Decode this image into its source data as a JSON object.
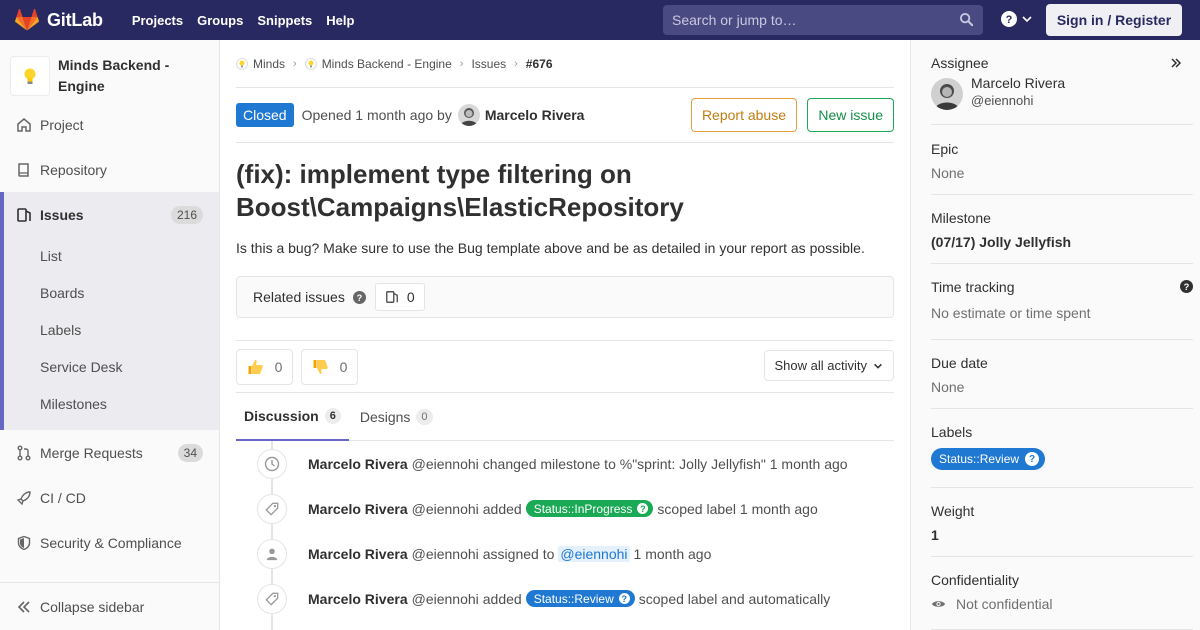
{
  "navbar": {
    "brand": "GitLab",
    "links": [
      "Projects",
      "Groups",
      "Snippets",
      "Help"
    ],
    "search_placeholder": "Search or jump to…",
    "signin_label": "Sign in / Register"
  },
  "sidebar": {
    "project_name": "Minds Backend - Engine",
    "items": [
      {
        "label": "Project",
        "icon": "home-icon"
      },
      {
        "label": "Repository",
        "icon": "book-icon"
      },
      {
        "label": "Issues",
        "icon": "issues-icon",
        "count": "216"
      },
      {
        "label": "Merge Requests",
        "icon": "merge-request-icon",
        "count": "34"
      },
      {
        "label": "CI / CD",
        "icon": "rocket-icon"
      },
      {
        "label": "Security & Compliance",
        "icon": "shield-icon"
      }
    ],
    "issue_subitems": [
      "List",
      "Boards",
      "Labels",
      "Service Desk",
      "Milestones"
    ],
    "collapse_label": "Collapse sidebar"
  },
  "breadcrumb": [
    "Minds",
    "Minds Backend - Engine",
    "Issues",
    "#676"
  ],
  "issue": {
    "status": "Closed",
    "opened_text": "Opened 1 month ago by",
    "author": "Marcelo Rivera",
    "report_abuse_label": "Report abuse",
    "new_issue_label": "New issue",
    "title": "(fix): implement type filtering on Boost\\Campaigns\\ElasticRepository",
    "description": "Is this a bug? Make sure to use the Bug template above and be as detailed in your report as possible.",
    "related_label": "Related issues",
    "related_count": "0"
  },
  "awards": {
    "thumbs_up": "0",
    "thumbs_down": "0",
    "activity_filter": "Show all activity"
  },
  "tabs": [
    {
      "label": "Discussion",
      "count": "6"
    },
    {
      "label": "Designs",
      "count": "0"
    }
  ],
  "timeline": [
    {
      "icon": "clock-icon",
      "who": "Marcelo Rivera",
      "user": "@eiennohi",
      "text": "changed milestone to %\"sprint: Jolly Jellyfish\" 1 month ago"
    },
    {
      "icon": "tag-icon",
      "who": "Marcelo Rivera",
      "user": "@eiennohi",
      "pre": "added",
      "label": "Status::InProgress",
      "label_color": "#1aaa55",
      "post": "scoped label 1 month ago"
    },
    {
      "icon": "user-icon",
      "who": "Marcelo Rivera",
      "user": "@eiennohi",
      "pre": "assigned to",
      "mention": "@eiennohi",
      "post": "1 month ago"
    },
    {
      "icon": "tag-icon",
      "who": "Marcelo Rivera",
      "user": "@eiennohi",
      "pre": "added",
      "label": "Status::Review",
      "label_color": "#1f78d1",
      "post": "scoped label and automatically"
    }
  ],
  "right_sidebar": {
    "assignee_title": "Assignee",
    "assignee_name": "Marcelo Rivera",
    "assignee_user": "@eiennohi",
    "epic_title": "Epic",
    "epic_value": "None",
    "milestone_title": "Milestone",
    "milestone_value": "(07/17) Jolly Jellyfish",
    "time_title": "Time tracking",
    "time_value": "No estimate or time spent",
    "due_title": "Due date",
    "due_value": "None",
    "labels_title": "Labels",
    "label_value": "Status::Review",
    "weight_title": "Weight",
    "weight_value": "1",
    "confidentiality_title": "Confidentiality",
    "confidentiality_value": "Not confidential"
  },
  "colors": {
    "navbar": "#292961",
    "accent": "#6666c4",
    "closed_badge": "#1f78d1",
    "label_inprogress": "#1aaa55",
    "label_review": "#1f78d1"
  }
}
